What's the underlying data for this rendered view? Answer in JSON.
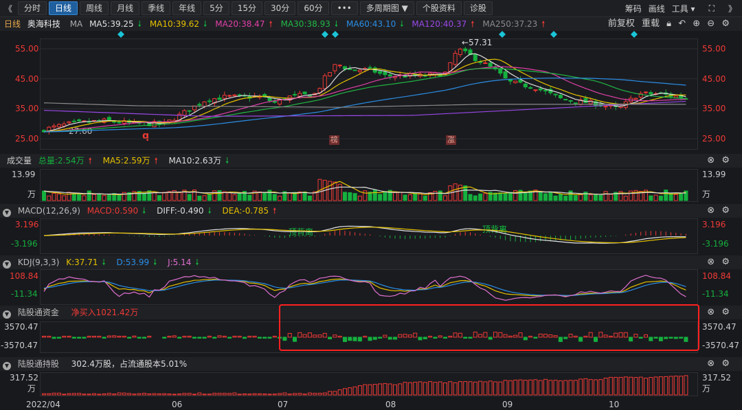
{
  "toolbar": {
    "back": "《",
    "periods": [
      "分时",
      "日线",
      "周线",
      "月线",
      "季线",
      "年线",
      "5分",
      "15分",
      "30分",
      "60分"
    ],
    "active": "日线",
    "more": "•••",
    "multi": "多周期图 ▼",
    "profile": "个股资料",
    "diagnose": "诊股",
    "right": [
      "筹码",
      "画线",
      "工具 ▾"
    ],
    "fullscreen": "⛶",
    "forward": "》"
  },
  "main": {
    "period": "日线",
    "name": "奥海科技",
    "indicator": "MA",
    "ma": [
      {
        "label": "MA5:39.25",
        "dir": "down",
        "color": "#e0e0e0"
      },
      {
        "label": "MA10:39.62",
        "dir": "down",
        "color": "#e6c200"
      },
      {
        "label": "MA20:38.47",
        "dir": "up",
        "color": "#e040a8"
      },
      {
        "label": "MA30:38.93",
        "dir": "down",
        "color": "#22b845"
      },
      {
        "label": "MA60:43.10",
        "dir": "down",
        "color": "#2a8ee6"
      },
      {
        "label": "MA120:40.37",
        "dir": "up",
        "color": "#9a48e8"
      },
      {
        "label": "MA250:37.23",
        "dir": "up",
        "color": "#8a8a8a"
      }
    ],
    "adjust": "前复权",
    "reload": "重载",
    "yticks": [
      "55.00",
      "45.00",
      "35.00",
      "25.00"
    ],
    "high_label": "←57.31",
    "low_label": "27.60",
    "tags": [
      "q",
      "榜",
      "涨"
    ]
  },
  "volume": {
    "title": "成交量",
    "total": "总量:2.54万",
    "ma5": "MA5:2.59万",
    "ma10": "MA10:2.63万",
    "ymax": "13.99",
    "unit": "万"
  },
  "macd": {
    "title": "MACD(12,26,9)",
    "macd": "MACD:0.590",
    "diff": "DIFF:-0.490",
    "dea": "DEA:-0.785",
    "ymax": "3.196",
    "ymin": "-3.196",
    "annotation": "顶背离"
  },
  "kdj": {
    "title": "KDJ(9,3,3)",
    "k": "K:37.71",
    "d": "D:53.99",
    "j": "J:5.14",
    "ymax": "108.84",
    "ymin": "-11.34"
  },
  "fund": {
    "title": "陆股通资金",
    "net": "净买入1021.42万",
    "ymax": "3570.47",
    "ymin": "-3570.47"
  },
  "hold": {
    "title": "陆股通持股",
    "summary": "302.4万股，占流通股本5.01%",
    "ymax": "317.52",
    "unit": "万"
  },
  "dates": [
    "2022/04",
    "06",
    "07",
    "08",
    "09",
    "10"
  ],
  "colors": {
    "up": "#f03a35",
    "down": "#15b03e",
    "accent": "#1f5f9e",
    "highlight": "#ff2020",
    "marker": "#1bc4d6"
  },
  "arrows": {
    "up": "🠕",
    "down": "🠗"
  }
}
